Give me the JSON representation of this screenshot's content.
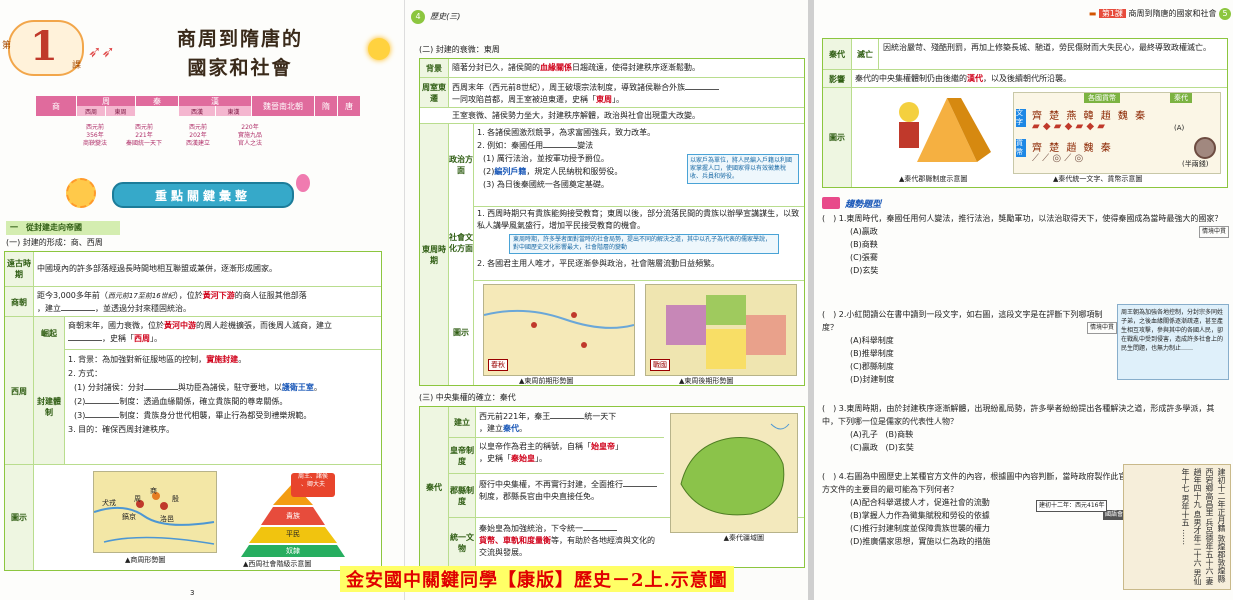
{
  "page1": {
    "lesson_word": "第",
    "lesson_num": "1",
    "lesson_suffix": "課",
    "title_line1": "商周到隋唐的",
    "title_line2": "國家和社會",
    "timeline": {
      "top": [
        "商",
        "周",
        "秦",
        "漢",
        "魏晉南北朝",
        "隋",
        "唐"
      ],
      "sub": [
        "西周",
        "東周",
        "西漢",
        "東漢"
      ],
      "notes": [
        "西元前\n356年\n商鞅變法",
        "西元前\n221年\n秦國統一天下",
        "西元前\n202年\n西漢建立",
        "220年\n實施九品\n官人之法"
      ]
    },
    "banner": "重點關鍵彙整",
    "section1_title": "一　從封建走向帝國",
    "section1_sub": "(一) 封建的形成：商、西周",
    "rows": [
      {
        "label": "遠古時期",
        "text": "中國境內的許多部落經過長時間地相互聯盟或兼併，逐漸形成國家。"
      },
      {
        "label": "商朝",
        "text_a": "距今3,000多年前（",
        "text_era": "西元前17至前16世紀",
        "text_b": "），位於",
        "text_hl": "黃河下游",
        "text_c": "的商人征服其他部落",
        "text_d": "，建立",
        "text_e": "，並透過分封來穩固統治。"
      },
      {
        "label": "崛起",
        "text_a": "商朝末年，國力衰微，位於",
        "text_hl": "黃河中游",
        "text_b": "的周人趁機擴張，而後周人滅商，建立",
        "text_c": "，史稱「",
        "text_hl2": "西周",
        "text_d": "」。"
      }
    ],
    "xizhou_label": "西周",
    "fengjian_label": "封建體制",
    "fengjian": {
      "p1a": "1. 背景：為加強對新征服地區的控制，",
      "p1b": "實施封建",
      "p1c": "。",
      "p2": "2. 方式：",
      "p3a": "(1) 分封諸侯：分封",
      "p3b": "與功臣為諸侯，駐守要地，以",
      "p3c": "護衛王室",
      "p3d": "。",
      "p4a": "(2)",
      "p4b": "制度：透過血緣關係，確立貴族間的尊卑關係。",
      "p5a": "(3)",
      "p5b": "制度：貴族身分世代相襲，畢止行為都受到禮樂規範。",
      "p6": "3. 目的：確保西周封建秩序。"
    },
    "tushi_label": "圖示",
    "map1_caption": "▲商周形勢圖",
    "map1_labels": [
      "鎬京",
      "洛邑",
      "殷",
      "周",
      "商",
      "犬戎"
    ],
    "pyramid": {
      "top": "周王、諸侯\n、卿大夫",
      "mid1": "貴族",
      "mid2": "平民",
      "bottom": "奴隸"
    },
    "pyramid_caption": "▲西周社會階級示意圖",
    "page_num": "3"
  },
  "page2": {
    "header_num": "4",
    "header_title": "歷史(三)",
    "section2_title": "(二) 封建的衰微：東周",
    "rows": [
      {
        "label": "背景",
        "a": "隨著分封已久，諸侯間的",
        "hl": "血緣關係",
        "b": "日趨疏遠，使得封建秩序逐漸鬆動。"
      },
      {
        "label": "周室東遷",
        "a": "西周末年（西元前8世紀），周王破壞宗法制度，導致諸侯聯合外族",
        "b": "一同攻陷首都，周王室被迫東遷，史稱「",
        "hl": "東周",
        "c": "」。"
      },
      {
        "label": "",
        "a": "王室衰微、諸侯勢力坐大，封建秩序解體，政治與社會出現重大改變。"
      }
    ],
    "donghzou_label": "東周時期",
    "zhengzhi_label": "政治方面",
    "zhengzhi": [
      "1. 各諸侯國激烈競爭，為求富國強兵，致力改革。",
      "2. 例如：秦國任用",
      "變法",
      "(1) 厲行法治，並按軍功授予爵位。",
      "(2)",
      "編列戶籍",
      "，規定人民納稅和服勞役。",
      "(3) 為日後秦國統一各國奠定基礎。"
    ],
    "note_box": "以家戶為單位，將人民編入戶籍以利國家掌握人口，使國家得以有效徵集稅收、兵員和勞役。",
    "shehui_label": "社會文化方面",
    "shehui": [
      "1. 西周時期只有貴族能夠接受教育；東周以後，部分流落民間的貴族以辦學宣講謀生，以致私人講學風氣盛行，增加平民接受教育的機會。",
      "東周時期，許多學者面對當時的社會局勢，提出不同的解決之道，其中以孔子為代表的儒家學說，對中國歷史文化影響最大，社會階層的變動",
      "2. 各國君主用人唯才，平民逐漸參與政治，社會階層流動日益頻繁。"
    ],
    "tushi_label": "圖示",
    "map_left_caption": "▲東周前期形勢圖",
    "map_left_tag": "春秋",
    "map_right_caption": "▲東周後期形勢圖",
    "map_right_tag": "戰國",
    "section3_title": "(三) 中央集權的確立：秦代",
    "qin_label": "秦代",
    "qin_rows": [
      {
        "label": "建立",
        "a": "西元前221年，秦王",
        "b": "統一天下",
        "c": "，建立",
        "hl": "秦代",
        "d": "。"
      },
      {
        "label": "皇帝制度",
        "a": "以皇帝作為君主的稱號，自稱「",
        "hl": "始皇帝",
        "b": "」",
        "c": "，史稱「",
        "hl2": "秦始皇",
        "d": "」。"
      },
      {
        "label": "郡縣制度",
        "a": "廢行中央集權，不再實行封建，全面推行",
        "b": "制度，郡縣長官由中央直接任免。"
      },
      {
        "label": "統一文物",
        "a": "秦始皇為加強統治，下令統一",
        "hl": "貨幣、車軌和度量衡",
        "b": "等，有助於各地經濟與文化的交流與發展。"
      }
    ],
    "qin_map_caption": "▲秦代疆域圖"
  },
  "page3": {
    "header_lesson": "第1課",
    "header_title": "商周到隋唐的國家和社會",
    "header_num": "5",
    "rows": [
      {
        "label1": "秦代",
        "label2": "滅亡",
        "text": "因統治嚴苛、殘酷刑罰，再加上修築長城、馳道，勞民傷財而大失民心，最終導致政權滅亡。"
      },
      {
        "label1": "影響",
        "a": "秦代的中央集權體制仍由後繼的",
        "hl": "漢代",
        "b": "，以及後續朝代所沿襲。"
      }
    ],
    "tushi_label": "圖示",
    "pyramid_caption": "▲秦代郡縣制度示意圖",
    "script_caption": "▲秦代統一文字、貨幣示意圖",
    "script_labels": {
      "left_title": "各國貨幣",
      "right_title": "秦代",
      "wenzi": "文字",
      "huobi": "貨幣",
      "coin": "(半兩錢)",
      "a": "(A)"
    },
    "trend_title": "趨勢題型",
    "questions": [
      {
        "num": "(　) 1.",
        "stem": "東周時代，秦國任用何人變法，推行法治，獎勵軍功，以法治取得天下，使得秦國成為當時最強大的國家？",
        "tag": "情境中貫",
        "options": [
          "(A)贏政",
          "(B)商鞅",
          "(C)張騫",
          "(D)玄奘"
        ]
      },
      {
        "num": "(　) 2.",
        "stem": "小紅閱讀公在書中讀到一段文字，如右圖，這段文字是在評斷下列哪項制度？",
        "tag": "情境中貫",
        "options": [
          "(A)科舉制度",
          "(B)推舉制度",
          "(C)郡縣制度",
          "(D)封建制度"
        ]
      },
      {
        "num": "(　) 3.",
        "stem": "東周時期，由於封建秩序逐漸解體，出現紛亂局勢，許多學者紛紛提出各種解決之道，形成許多學派，其中，下列哪一位是儒家的代表性人物？",
        "options": [
          "(A)孔子",
          "(B)商鞅",
          "(C)贏政",
          "(D)玄奘"
        ]
      },
      {
        "num": "(　) 4.",
        "stem": "右圖為中國歷史上某種官方文件的內容，根據圖中內容判斷，當時政府製作此官方文件的主要目的最可能為下列何者？",
        "tag": "國語會考",
        "options": [
          "(A)配合科舉選拔人才，促進社會的流動",
          "(B)掌握人力作為徵集賦稅和勞役的依據",
          "(C)推行封建制度並保障貴族世襲的權力",
          "(D)推廣儒家思想，實施以仁為政的措施"
        ]
      }
    ],
    "quote_box": "周王朝為加強各地控制，分封宗多同姓子弟，之後血緣關係逐漸疏遠，甚至產生相互攻擊，參與其中的各國人民，卻在戰亂中受到侵害，造成許多社會上的民生問題，也無力制止……",
    "doc_inset": "建初十二年：西元416年",
    "doc_text": "建初十二年正月籍 敦煌郡敦煌縣西宕鄉高昌里 兵呂德年五十六 妻趙年四十九 息男才年二十六 男仙年十七 男年十五 ……"
  },
  "footer": "金安國中關鍵同學【康版】歷史－2上.示意圖"
}
